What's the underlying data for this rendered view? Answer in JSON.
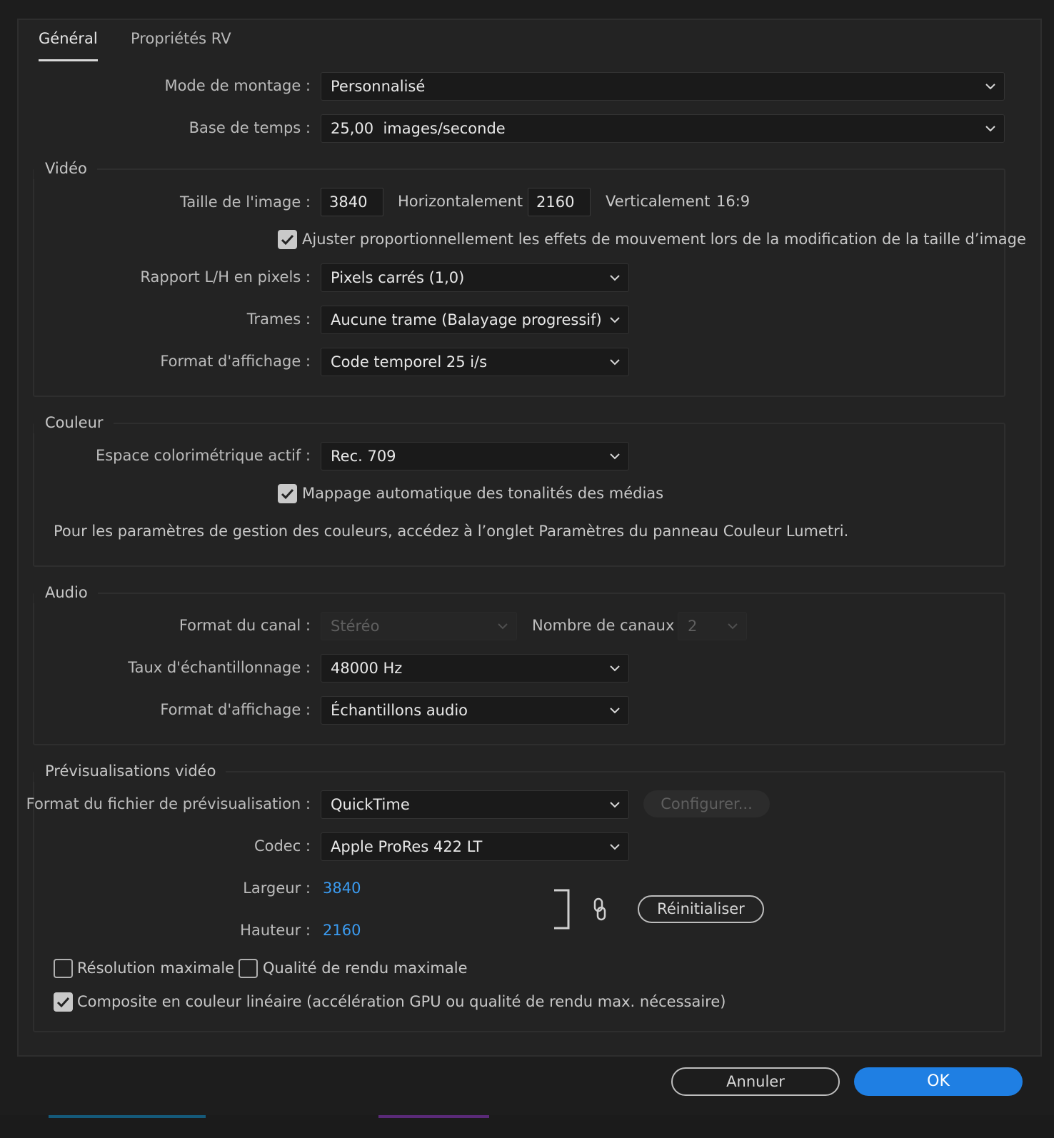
{
  "tabs": [
    {
      "label": "Général",
      "active": true
    },
    {
      "label": "Propriétés RV",
      "active": false
    }
  ],
  "general": {
    "editing_mode_label": "Mode de montage :",
    "editing_mode_value": "Personnalisé",
    "timebase_label": "Base de temps :",
    "timebase_value": "25,00  images/seconde"
  },
  "video": {
    "title": "Vidéo",
    "frame_size_label": "Taille de l'image :",
    "width_value": "3840",
    "horizontal_label": "Horizontalement",
    "height_value": "2160",
    "vertical_label": "Verticalement",
    "aspect_ratio": "16:9",
    "scale_motion_label": "Ajuster proportionnellement les effets de mouvement lors de la modification de la taille d’image",
    "scale_motion_checked": true,
    "pixel_aspect_label": "Rapport L/H en pixels :",
    "pixel_aspect_value": "Pixels carrés (1,0)",
    "fields_label": "Trames :",
    "fields_value": "Aucune trame (Balayage progressif)",
    "display_format_label": "Format d'affichage :",
    "display_format_value": "Code temporel 25 i/s"
  },
  "color": {
    "title": "Couleur",
    "working_space_label": "Espace colorimétrique actif :",
    "working_space_value": "Rec. 709",
    "auto_tone_label": "Mappage automatique des tonalités des médias",
    "auto_tone_checked": true,
    "info_text": "Pour les paramètres de gestion des couleurs, accédez à l’onglet Paramètres du panneau Couleur Lumetri."
  },
  "audio": {
    "title": "Audio",
    "channel_format_label": "Format du canal :",
    "channel_format_value": "Stéréo",
    "channel_count_label": "Nombre de canaux :",
    "channel_count_value": "2",
    "sample_rate_label": "Taux d'échantillonnage :",
    "sample_rate_value": "48000 Hz",
    "display_format_label": "Format d'affichage :",
    "display_format_value": "Échantillons audio"
  },
  "previews": {
    "title": "Prévisualisations vidéo",
    "file_format_label": "Format du fichier de prévisualisation :",
    "file_format_value": "QuickTime",
    "configure_label": "Configurer...",
    "codec_label": "Codec :",
    "codec_value": "Apple ProRes 422 LT",
    "width_label": "Largeur :",
    "width_value": "3840",
    "height_label": "Hauteur :",
    "height_value": "2160",
    "reset_label": "Réinitialiser",
    "max_bit_depth_label": "Résolution maximale",
    "max_bit_depth_checked": false,
    "max_render_quality_label": "Qualité de rendu maximale",
    "max_render_quality_checked": false,
    "linear_color_label": "Composite en couleur linéaire (accélération GPU ou qualité de rendu max. nécessaire)",
    "linear_color_checked": true
  },
  "footer": {
    "cancel_label": "Annuler",
    "ok_label": "OK"
  },
  "colors": {
    "accent": "#1f7fe3",
    "link": "#3b9bf0",
    "background": "#232323"
  }
}
